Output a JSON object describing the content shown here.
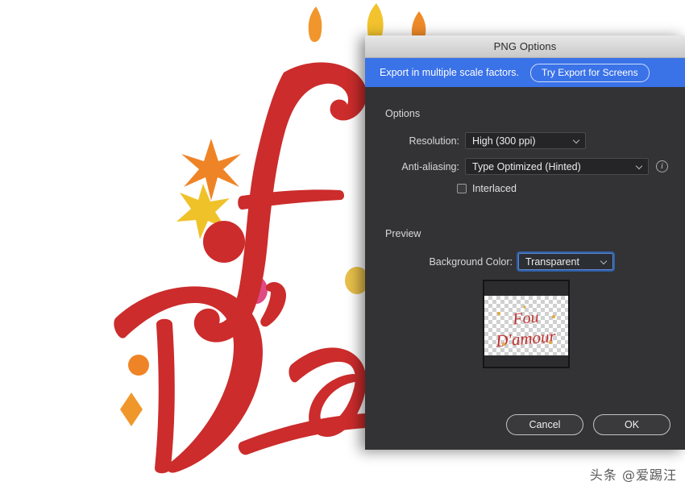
{
  "artwork": {
    "name": "fou-damour-lettering",
    "line1": "Fou",
    "line2": "D'amour",
    "colors": {
      "script_red": "#cc2c2c",
      "star_orange": "#ef8426",
      "star_yellow": "#f0c22a",
      "dot_pink": "#e0487f",
      "dot_yellow": "#e8c04a",
      "teardrop_orange": "#f0962c",
      "teardrop_yellow": "#f2c32e",
      "canvas": "#ffffff"
    }
  },
  "dialog": {
    "title": "PNG Options",
    "banner": {
      "message": "Export in multiple scale factors.",
      "button_label": "Try Export for Screens",
      "background": "#3a72e8"
    },
    "options": {
      "section_label": "Options",
      "resolution": {
        "label": "Resolution:",
        "value": "High (300 ppi)"
      },
      "anti_aliasing": {
        "label": "Anti-aliasing:",
        "value": "Type Optimized (Hinted)",
        "info_icon": "info-icon"
      },
      "interlaced": {
        "label": "Interlaced",
        "checked": false
      }
    },
    "preview": {
      "section_label": "Preview",
      "background_color": {
        "label": "Background Color:",
        "value": "Transparent",
        "focused": true
      },
      "thumbnail_alt": "Fou D'amour"
    },
    "footer": {
      "cancel_label": "Cancel",
      "ok_label": "OK"
    }
  },
  "watermark": {
    "text": "头条 @爱踢汪"
  }
}
